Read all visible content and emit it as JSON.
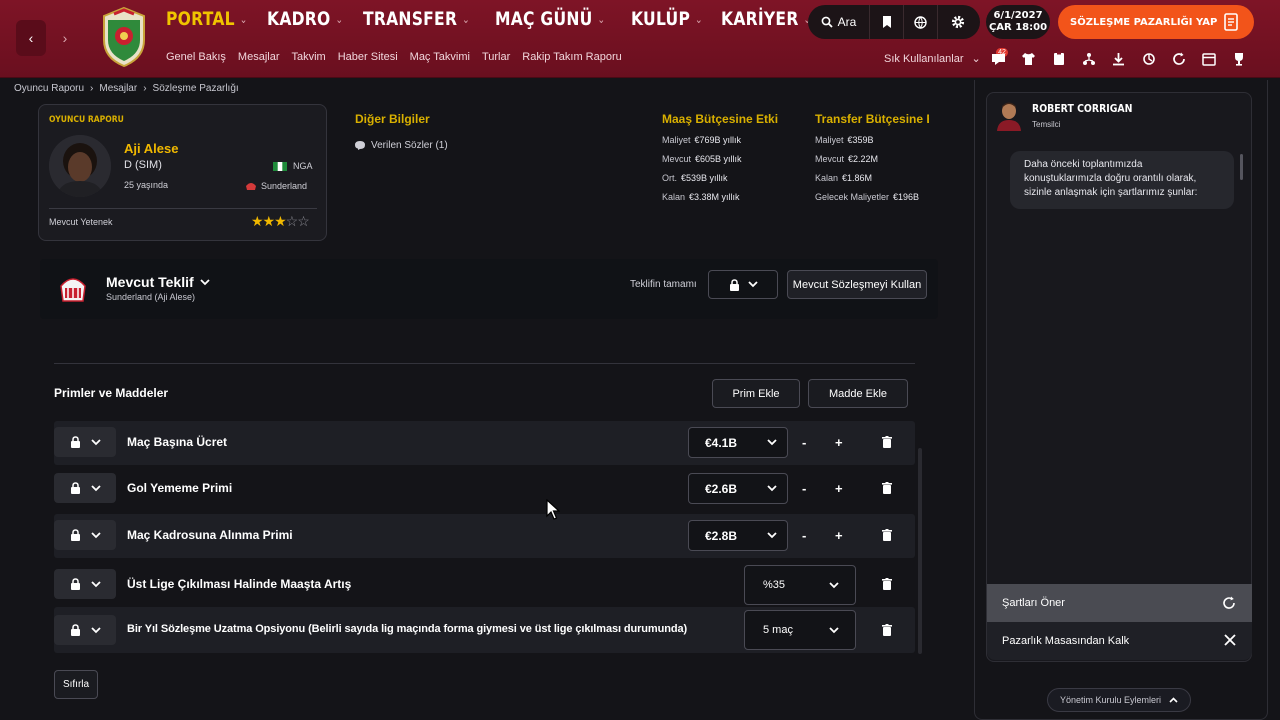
{
  "topbar": {
    "main_nav": [
      {
        "label": "PORTAL",
        "active": true
      },
      {
        "label": "KADRO",
        "active": false
      },
      {
        "label": "TRANSFER",
        "active": false
      },
      {
        "label": "MAÇ GÜNÜ",
        "active": false
      },
      {
        "label": "KULÜP",
        "active": false
      },
      {
        "label": "KARİYER",
        "active": false
      }
    ],
    "sub_nav": [
      "Genel Bakış",
      "Mesajlar",
      "Takvim",
      "Haber Sitesi",
      "Maç Takvimi",
      "Turlar",
      "Rakip Takım Raporu"
    ],
    "search_label": "Ara",
    "date_line1": "6/1/2027",
    "date_line2": "ÇAR  18:00",
    "cta_label": "SÖZLEŞME PAZARLIĞI YAP",
    "frequent_label": "Sık Kullanılanlar",
    "notification_count": "42",
    "accent_color": "#7e1426",
    "cta_color": "#f2541a"
  },
  "breadcrumb": [
    "Oyuncu Raporu",
    "Mesajlar",
    "Sözleşme Pazarlığı"
  ],
  "player_card": {
    "label": "OYUNCU RAPORU",
    "name": "Aji Alese",
    "position": "D (SIM)",
    "age": "25 yaşında",
    "nationality": "NGA",
    "club": "Sunderland",
    "ability_label": "Mevcut Yetenek",
    "stars_filled": 3,
    "stars_total": 5,
    "stars_text_filled": "★★★",
    "stars_text_empty": "☆☆"
  },
  "other_info": {
    "title": "Diğer Bilgiler",
    "item": "Verilen Sözler (1)"
  },
  "wage_budget": {
    "title": "Maaş Bütçesine Etki",
    "rows": [
      {
        "label": "Maliyet",
        "value": "€769B yıllık"
      },
      {
        "label": "Mevcut",
        "value": "€605B yıllık"
      },
      {
        "label": "Ort.",
        "value": "€539B yıllık"
      },
      {
        "label": "Kalan",
        "value": "€3.38M yıllık"
      }
    ]
  },
  "transfer_budget": {
    "title": "Transfer Bütçesine E",
    "rows": [
      {
        "label": "Maliyet",
        "value": "€359B"
      },
      {
        "label": "Mevcut",
        "value": "€2.22M"
      },
      {
        "label": "Kalan",
        "value": "€1.86M"
      },
      {
        "label": "Gelecek Maliyetler",
        "value": "€196B"
      }
    ]
  },
  "offer": {
    "title": "Mevcut Teklif",
    "subtitle": "Sunderland  (Aji Alese)",
    "whole_label": "Teklifin tamamı",
    "use_current_label": "Mevcut Sözleşmeyi Kullan"
  },
  "bonuses": {
    "title": "Primler ve Maddeler",
    "add_bonus_label": "Prim Ekle",
    "add_clause_label": "Madde Ekle",
    "reset_label": "Sıfırla",
    "minus": "-",
    "plus": "+",
    "rows": [
      {
        "label": "Maç Başına Ücret",
        "value": "€4.1B"
      },
      {
        "label": "Gol Yememe Primi",
        "value": "€2.6B"
      },
      {
        "label": "Maç Kadrosuna Alınma Primi",
        "value": "€2.8B"
      },
      {
        "label": "Üst Lige Çıkılması Halinde Maaşta Artış",
        "value": "%35"
      },
      {
        "label": "Bir Yıl Sözleşme Uzatma Opsiyonu (Belirli sayıda lig maçında forma giymesi ve üst lige çıkılması durumunda)",
        "value": "5 maç"
      }
    ]
  },
  "agent": {
    "name": "ROBERT CORRIGAN",
    "role": "Temsilci",
    "message": "Daha önceki toplantımızda konuştuklarımızla doğru orantılı olarak, sizinle anlaşmak için şartlarımız şunlar:",
    "propose_label": "Şartları Öner",
    "leave_label": "Pazarlık Masasından Kalk",
    "board_label": "Yönetim Kurulu Eylemleri"
  }
}
